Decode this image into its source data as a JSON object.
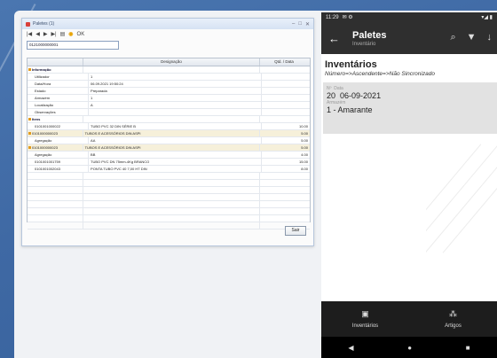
{
  "desktop": {
    "title": "Paletes (1)",
    "ok_label": "OK",
    "pallet_code": "0121000000001",
    "columns": [
      "",
      "Designação",
      "Qtd. / Data"
    ],
    "rows": [
      {
        "c1": "Informação",
        "c2": "",
        "c3": "",
        "group": true
      },
      {
        "c1": "Utilizador",
        "c2": "1",
        "c3": ""
      },
      {
        "c1": "Data/Hora",
        "c2": "06.09.2021 19:50:24",
        "c3": ""
      },
      {
        "c1": "Estado",
        "c2": "Preparada",
        "c3": ""
      },
      {
        "c1": "Armazém",
        "c2": "1",
        "c3": ""
      },
      {
        "c1": "Localização",
        "c2": "A",
        "c3": ""
      },
      {
        "c1": "Observações",
        "c2": "",
        "c3": ""
      },
      {
        "c1": "Itens",
        "c2": "",
        "c3": "",
        "group": true
      },
      {
        "c1": "0101001000022",
        "c2": "TUBO PVC 32 DIN SÉRIE B",
        "c3": "10.00"
      },
      {
        "c1": "0101000000023",
        "c2": "TUBOS E ACESSÓRIOS DIN ASPI",
        "c3": "5.00",
        "sel": true
      },
      {
        "c1": "Agregação",
        "c2": "AA",
        "c3": "5.00"
      },
      {
        "c1": "0101000000023",
        "c2": "TUBOS E ACESSÓRIOS DIN ASPI",
        "c3": "5.00",
        "sel": true
      },
      {
        "c1": "Agregação",
        "c2": "BB",
        "c3": "4.00"
      },
      {
        "c1": "0101001001759",
        "c2": "TUBO PVC DN 75mm-4Kg BRANCO",
        "c3": "15.00"
      },
      {
        "c1": "0101001002043",
        "c2": "PONTA TUBO PVC 40 7,00 HT DIN",
        "c3": "8.00"
      }
    ],
    "exit_label": "Sair"
  },
  "tablet": {
    "status": {
      "time": "11:29",
      "icons_left": "✉ ⚙",
      "icons_right": "▾◢ ▮"
    },
    "appbar": {
      "title": "Paletes",
      "subtitle": "Inventário"
    },
    "section_title": "Inventários",
    "sort_line": "Número=>Ascendente=>Não Sincronizado",
    "card": {
      "number_label": "Nº",
      "date_label": "Data",
      "number": "20",
      "date": "06-09-2021",
      "warehouse_label": "Armazém",
      "warehouse": "1 - Amarante"
    },
    "nav": {
      "tab1": "Inventários",
      "tab2": "Artigos"
    }
  }
}
